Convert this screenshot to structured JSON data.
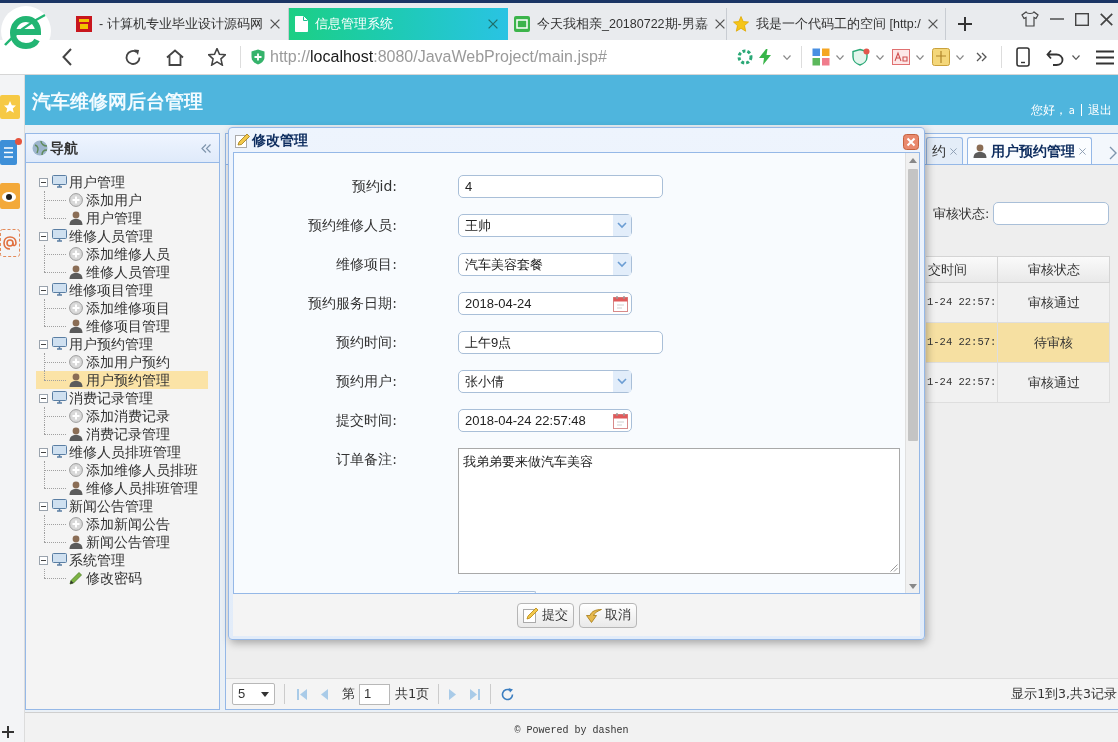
{
  "browser": {
    "tabs": [
      {
        "title": "- 计算机专业毕业设计源码网",
        "selected": false
      },
      {
        "title": "信息管理系统",
        "selected": true
      },
      {
        "title": "今天我相亲_20180722期-男嘉",
        "selected": false
      },
      {
        "title": "我是一个代码工的空间 [http:/",
        "selected": false
      }
    ],
    "address": {
      "scheme": "http://",
      "host": "localhost",
      "path": ":8080/JavaWebProject/main.jsp#"
    }
  },
  "header": {
    "title": "汽车维修网后台管理",
    "greeting": "您好，",
    "user": "a",
    "logout": "退出"
  },
  "nav": {
    "title": "导航",
    "items": [
      {
        "label": "用户管理",
        "expanded": true,
        "children": [
          {
            "label": "添加用户",
            "kind": "add",
            "selected": false
          },
          {
            "label": "用户管理",
            "kind": "manage",
            "selected": false
          }
        ]
      },
      {
        "label": "维修人员管理",
        "expanded": true,
        "children": [
          {
            "label": "添加维修人员",
            "kind": "add",
            "selected": false
          },
          {
            "label": "维修人员管理",
            "kind": "manage",
            "selected": false
          }
        ]
      },
      {
        "label": "维修项目管理",
        "expanded": true,
        "children": [
          {
            "label": "添加维修项目",
            "kind": "add",
            "selected": false
          },
          {
            "label": "维修项目管理",
            "kind": "manage",
            "selected": false
          }
        ]
      },
      {
        "label": "用户预约管理",
        "expanded": true,
        "children": [
          {
            "label": "添加用户预约",
            "kind": "add",
            "selected": false
          },
          {
            "label": "用户预约管理",
            "kind": "manage",
            "selected": true
          }
        ]
      },
      {
        "label": "消费记录管理",
        "expanded": true,
        "children": [
          {
            "label": "添加消费记录",
            "kind": "add",
            "selected": false
          },
          {
            "label": "消费记录管理",
            "kind": "manage",
            "selected": false
          }
        ]
      },
      {
        "label": "维修人员排班管理",
        "expanded": true,
        "children": [
          {
            "label": "添加维修人员排班",
            "kind": "add",
            "selected": false
          },
          {
            "label": "维修人员排班管理",
            "kind": "manage",
            "selected": false
          }
        ]
      },
      {
        "label": "新闻公告管理",
        "expanded": true,
        "children": [
          {
            "label": "添加新闻公告",
            "kind": "add",
            "selected": false
          },
          {
            "label": "新闻公告管理",
            "kind": "manage",
            "selected": false
          }
        ]
      },
      {
        "label": "系统管理",
        "expanded": true,
        "children": [
          {
            "label": "修改密码",
            "kind": "edit",
            "selected": false
          }
        ]
      }
    ]
  },
  "main": {
    "tabs": [
      {
        "label": "约",
        "selected": false
      },
      {
        "label": "用户预约管理",
        "selected": true
      }
    ],
    "search": {
      "label": "审核状态:"
    },
    "table": {
      "columns": [
        "交时间",
        "审核状态"
      ],
      "rows": [
        {
          "cells": [
            "1-24 22:57:",
            "审核通过"
          ],
          "selected": false
        },
        {
          "cells": [
            "1-24 22:57:",
            "待审核"
          ],
          "selected": true
        },
        {
          "cells": [
            "1-24 22:57:",
            "审核通过"
          ],
          "selected": false
        }
      ]
    },
    "pager": {
      "page_size": "5",
      "page_prefix": "第",
      "page": "1",
      "page_total": "共1页",
      "summary": "显示1到3,共3记录"
    }
  },
  "dialog": {
    "title": "修改管理",
    "fields": [
      {
        "label": "预约id:",
        "kind": "text",
        "value": "4"
      },
      {
        "label": "预约维修人员:",
        "kind": "select",
        "value": "王帅"
      },
      {
        "label": "维修项目:",
        "kind": "select",
        "value": "汽车美容套餐"
      },
      {
        "label": "预约服务日期:",
        "kind": "date",
        "value": "2018-04-24"
      },
      {
        "label": "预约时间:",
        "kind": "text",
        "value": "上午9点"
      },
      {
        "label": "预约用户:",
        "kind": "select",
        "value": "张小倩"
      },
      {
        "label": "提交时间:",
        "kind": "date",
        "value": "2018-04-24 22:57:48"
      },
      {
        "label": "订单备注:",
        "kind": "textarea",
        "value": "我弟弟要来做汽车美容"
      }
    ],
    "buttons": [
      {
        "label": "提交",
        "kind": "submit"
      },
      {
        "label": "取消",
        "kind": "cancel"
      }
    ]
  },
  "footer": {
    "text": "© Powered by dashen"
  }
}
